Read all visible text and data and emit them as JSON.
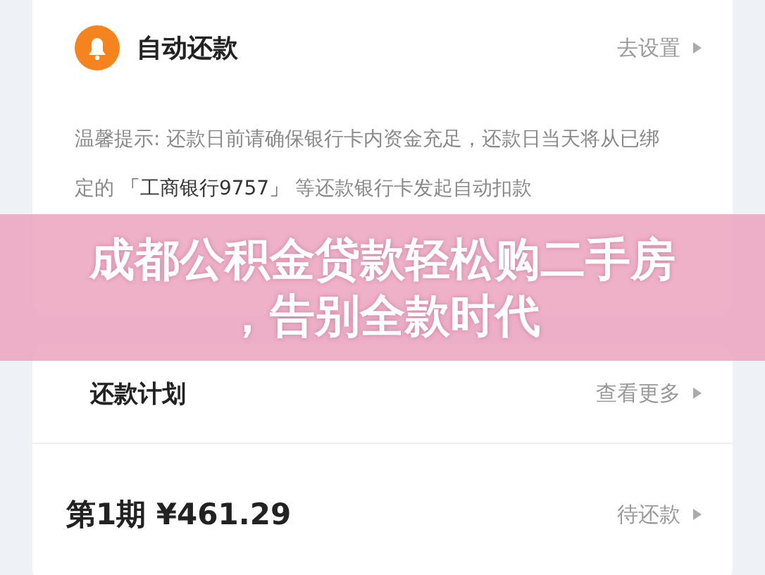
{
  "auto_repay": {
    "title": "自动还款",
    "action": "去设置",
    "tip": "温馨提示: 还款日前请确保银行卡内资金充足，还款日当天将从已绑定的 **「工商银行9757」** 等还款银行卡发起自动扣款"
  },
  "banner": {
    "lines": [
      "成都公积金贷款轻松购二手房",
      "，告别全款时代"
    ]
  },
  "plan": {
    "title": "还款计划",
    "action": "查看更多",
    "installments": [
      {
        "period": "第1期",
        "amount": "¥461.29",
        "status": "待还款"
      }
    ]
  }
}
